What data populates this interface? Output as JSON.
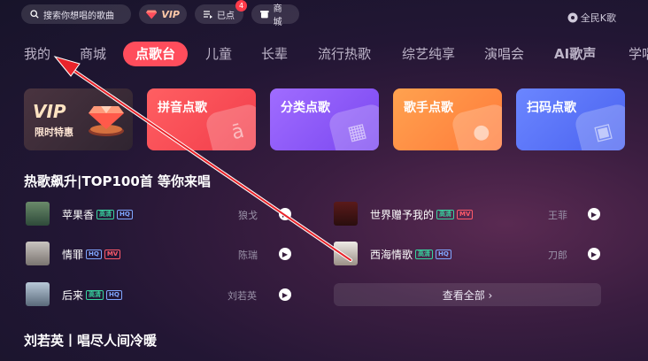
{
  "topbar": {
    "search_placeholder": "搜索你想唱的歌曲",
    "vip_label": "VIP",
    "queue_label": "已点",
    "queue_count": "4",
    "shop_label": "商城"
  },
  "logo": "全民K歌",
  "nav": [
    "我的",
    "商城",
    "点歌台",
    "儿童",
    "长辈",
    "流行热歌",
    "综艺纯享",
    "演唱会",
    "AI歌声",
    "学唱"
  ],
  "nav_active": "点歌台",
  "cards": {
    "vip_title": "VIP",
    "vip_subtitle": "限时特惠",
    "pinyin": "拼音点歌",
    "category": "分类点歌",
    "singer": "歌手点歌",
    "scan": "扫码点歌"
  },
  "section1_title": "热歌飙升|TOP100首 等你来唱",
  "tags": {
    "hd": "高清",
    "hq": "HQ",
    "mv": "MV"
  },
  "songs": [
    {
      "title": "苹果香",
      "artist": "狼戈",
      "tags": [
        "hd",
        "hq"
      ]
    },
    {
      "title": "世界赠予我的",
      "artist": "王菲",
      "tags": [
        "hd",
        "mv"
      ]
    },
    {
      "title": "情罪",
      "artist": "陈瑞",
      "tags": [
        "hq",
        "mv"
      ]
    },
    {
      "title": "西海情歌",
      "artist": "刀郎",
      "tags": [
        "hd",
        "hq"
      ]
    },
    {
      "title": "后来",
      "artist": "刘若英",
      "tags": [
        "hd",
        "hq"
      ]
    }
  ],
  "view_all": "查看全部 ›",
  "section2_title": "刘若英丨唱尽人间冷暖",
  "colors": {
    "accent": "#ff4d5c",
    "annotation": "#e8242b"
  },
  "icons": {
    "search": "search-icon",
    "vip": "diamond-icon",
    "queue": "playlist-icon",
    "shop": "shop-icon",
    "play": "play-icon"
  }
}
